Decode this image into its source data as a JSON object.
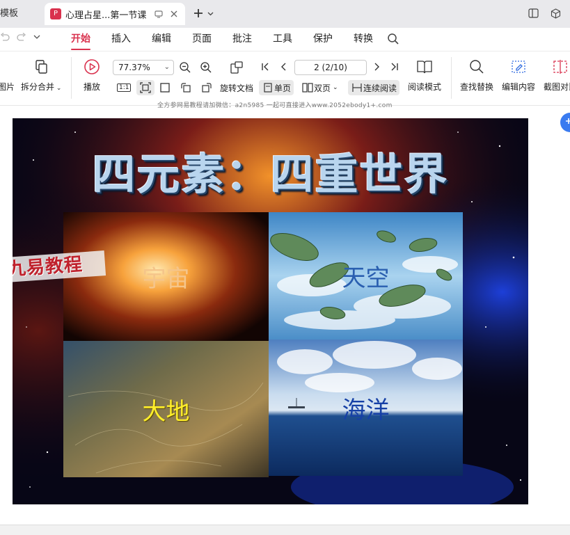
{
  "tabs": {
    "prev_title": "模板",
    "active_title": "心理占星...第一节课",
    "doc_logo_icon": "wps-pdf-logo"
  },
  "menu": {
    "items": [
      "开始",
      "插入",
      "编辑",
      "页面",
      "批注",
      "工具",
      "保护",
      "转换"
    ],
    "active": "开始"
  },
  "toolbar": {
    "image_label": "图片",
    "split_merge_label": "拆分合并",
    "play_label": "播放",
    "zoom_value": "77.37%",
    "page_value": "2 (2/10)",
    "rotate_label": "旋转文档",
    "single_label": "单页",
    "double_label": "双页",
    "continuous_label": "连续阅读",
    "read_mode_label": "阅读模式",
    "find_replace_label": "查找替换",
    "edit_content_label": "编辑内容",
    "screenshot_label": "截图对比",
    "actual_size_label": "1:1"
  },
  "document": {
    "header_text": "全方参网易教程请加微信：a2n5985 一起可直接进入www.2052ebody1+.com",
    "slide": {
      "title": "四元素：四重世界",
      "brand": "九易教程",
      "quadrants": [
        {
          "label": "宇宙",
          "color": "#f5c58a"
        },
        {
          "label": "天空",
          "color": "#2a5fb0"
        },
        {
          "label": "大地",
          "color": "#ffef2a"
        },
        {
          "label": "海洋",
          "color": "#1640a6"
        }
      ]
    }
  },
  "colors": {
    "accent": "#d9324e",
    "float_button": "#3a7bf0"
  }
}
